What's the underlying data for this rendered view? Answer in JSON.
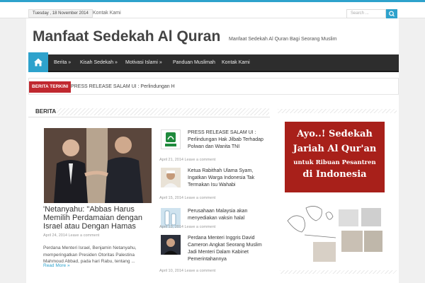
{
  "topbar": {
    "date": "Tuesday , 18 November 2014",
    "link": "Kontak Kami",
    "search_placeholder": "Search ..."
  },
  "header": {
    "title": "Manfaat Sedekah Al Quran",
    "tagline": "Manfaat Sedekah Al Quran Bagi Seorang Muslim"
  },
  "nav": {
    "items": [
      "Berita »",
      "Kisah Sedekah »",
      "Motivasi Islami »",
      "Panduan Muslimah",
      "Kontak Kami"
    ]
  },
  "ticker": {
    "label": "BERITA TERKINI",
    "text": "PRESS RELEASE SALAM UI : Perlindungan H"
  },
  "section": {
    "title": "BERITA"
  },
  "main_post": {
    "title": "'Netanyahu: \"Abbas Harus Memilih Perdamaian dengan Israel atau Dengan Hamas",
    "meta": "April 24, 2014 Leave a comment",
    "excerpt": "Perdana Menteri Israel, Benjamin Netanyahu, memperingatkan Presiden Otoritas Palestina Mahmoud Abbad, pada hari Rabu, tentang ...",
    "read_more": "Read More »"
  },
  "side_posts": [
    {
      "title": "PRESS RELEASE SALAM UI : Perlindungan Hak Jilbab Terhadap Polwan dan Wanita TNI",
      "meta": "April 21, 2014 Leave a comment"
    },
    {
      "title": "Ketua Rabithah Ulama Syam, Ingatkan Warga Indonesia Tak Termakan Isu Wahabi",
      "meta": "April 15, 2014 Leave a comment"
    },
    {
      "title": "Perusahaan Malaysia akan menyediakan vaksin halal",
      "meta": "April 13, 2014 Leave a comment"
    },
    {
      "title": "Perdana Menteri Inggris David Cameron Angkat Seorang Muslim Jadi Menteri Dalam Kabinet Pemerintahannya",
      "meta": "April 10, 2014 Leave a comment"
    }
  ],
  "ad": {
    "line1": "Ayo..! Sedekah",
    "line2": "Jariah Al Qur'an",
    "line3": "untuk Ribuan Pesantren",
    "line4": "di Indonesia"
  },
  "colors": {
    "accent": "#2ea2cc",
    "ticker_red": "#c0282f",
    "nav_bg": "#2d2d2d",
    "ad_red": "#a8201a"
  }
}
